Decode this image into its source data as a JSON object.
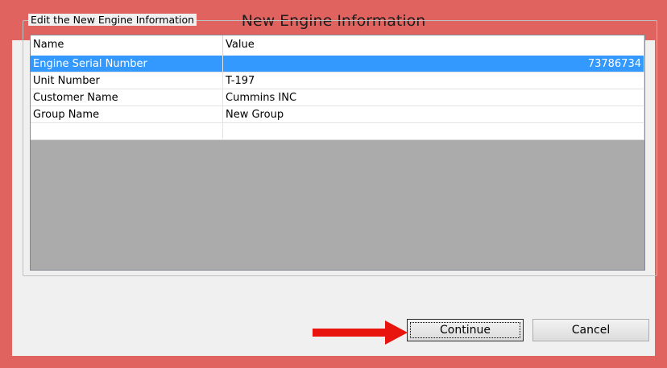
{
  "window": {
    "title": "New Engine Information"
  },
  "group": {
    "label": "Edit the New Engine Information"
  },
  "grid": {
    "columns": [
      "Name",
      "Value"
    ],
    "rows": [
      {
        "name": "Engine Serial Number",
        "value": "73786734",
        "selected": true
      },
      {
        "name": "Unit Number",
        "value": "T-197",
        "selected": false
      },
      {
        "name": "Customer Name",
        "value": "Cummins INC",
        "selected": false
      },
      {
        "name": "Group Name",
        "value": "New Group",
        "selected": false
      },
      {
        "name": "",
        "value": "",
        "selected": false
      }
    ]
  },
  "buttons": {
    "continue_label": "Continue",
    "cancel_label": "Cancel"
  },
  "colors": {
    "title_bar": "#e0635f",
    "selection": "#3399ff",
    "empty_grid_area": "#ababab",
    "annotation_arrow": "#e8150f"
  }
}
